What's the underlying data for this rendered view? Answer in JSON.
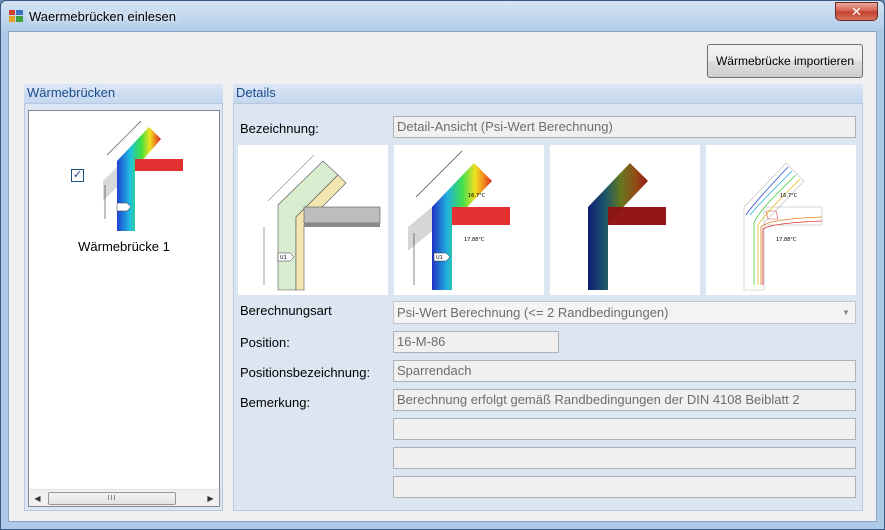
{
  "window": {
    "title": "Waermebrücken einlesen",
    "close_glyph": "✕"
  },
  "toolbar": {
    "import_label": "Wärmebrücke importieren"
  },
  "left": {
    "header": "Wärmebrücken",
    "items": [
      {
        "label": "Wärmebrücke 1",
        "checked": true,
        "check_glyph": "✓"
      }
    ],
    "scroll": {
      "left_glyph": "◀",
      "right_glyph": "▶",
      "thumb_glyph": "III"
    }
  },
  "details": {
    "header": "Details",
    "bezeichnung_label": "Bezeichnung:",
    "bezeichnung_value": "Detail-Ansicht (Psi-Wert Berechnung)",
    "images": [
      {
        "name": "construction-drawing",
        "annotations": [
          "U1"
        ]
      },
      {
        "name": "temperature-colormap",
        "annotations": [
          "16.7°C",
          "17.88°C",
          "U1"
        ]
      },
      {
        "name": "mesh-heat-flux",
        "annotations": []
      },
      {
        "name": "isotherm-lines",
        "annotations": [
          "16.7°C",
          "17.88°C"
        ]
      }
    ],
    "berechnungsart_label": "Berechnungsart",
    "berechnungsart_value": "Psi-Wert Berechnung (<= 2 Randbedingungen)",
    "dropdown_glyph": "▼",
    "position_label": "Position:",
    "position_value": "16-M-86",
    "positionsbez_label": "Positionsbezeichnung:",
    "positionsbez_value": "Sparrendach",
    "bemerkung_label": "Bemerkung:",
    "bemerkung_lines": [
      "Berechnung erfolgt gemäß Randbedingungen der DIN 4108 Beiblatt 2",
      "",
      "",
      ""
    ]
  },
  "colors": {
    "title_bar": "#b9d1ea",
    "panel": "#dce6f2",
    "header_text": "#1a4a8a",
    "close": "#c1402f"
  }
}
